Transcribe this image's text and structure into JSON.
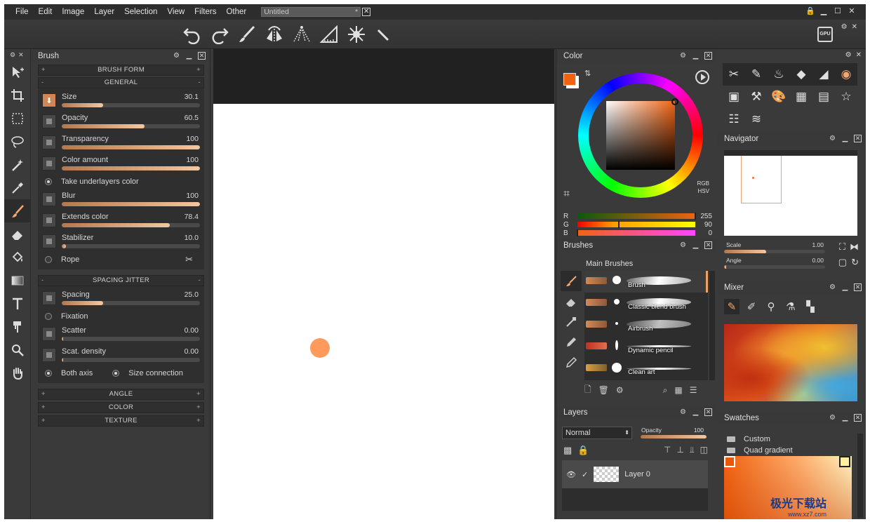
{
  "menu": [
    "File",
    "Edit",
    "Image",
    "Layer",
    "Selection",
    "View",
    "Filters",
    "Other"
  ],
  "document": {
    "tab_title": "Untitled",
    "modified_marker": "*"
  },
  "toolbar": {
    "gpu_label": "GPU",
    "icons": [
      "undo-icon",
      "redo-icon",
      "brush-tool-icon",
      "symmetry-icon",
      "perspective-icon",
      "ruler-triangle-icon",
      "mandala-icon",
      "straight-ruler-icon"
    ]
  },
  "left_tools": [
    "move-tool-icon",
    "crop-tool-icon",
    "rect-select-icon",
    "lasso-icon",
    "magic-wand-icon",
    "eyedropper-icon",
    "brush-icon",
    "eraser-icon",
    "fill-bucket-icon",
    "gradient-icon",
    "text-tool-icon",
    "clone-stamp-icon",
    "zoom-icon",
    "hand-icon"
  ],
  "brush_panel": {
    "title": "Brush",
    "sections": {
      "brush_form": "BRUSH FORM",
      "general": "GENERAL",
      "spacing_jitter": "SPACING JITTER",
      "angle": "ANGLE",
      "color": "COLOR",
      "texture": "TEXTURE"
    },
    "general": [
      {
        "label": "Size",
        "value": "30.1",
        "fill": 0.3
      },
      {
        "label": "Opacity",
        "value": "60.5",
        "fill": 0.6
      },
      {
        "label": "Transparency",
        "value": "100",
        "fill": 1.0
      },
      {
        "label": "Color amount",
        "value": "100",
        "fill": 1.0
      }
    ],
    "take_underlayers": "Take underlayers color",
    "general2": [
      {
        "label": "Blur",
        "value": "100",
        "fill": 1.0
      },
      {
        "label": "Extends color",
        "value": "78.4",
        "fill": 0.78
      },
      {
        "label": "Stabilizer",
        "value": "10.0",
        "fill": 0.03
      }
    ],
    "rope": "Rope",
    "spacing": [
      {
        "label": "Spacing",
        "value": "25.0",
        "fill": 0.3
      }
    ],
    "fixation": "Fixation",
    "spacing2": [
      {
        "label": "Scatter",
        "value": "0.00",
        "fill": 0.01
      },
      {
        "label": "Scat. density",
        "value": "0.00",
        "fill": 0.01
      }
    ],
    "both_axis": "Both axis",
    "size_connection": "Size connection"
  },
  "color_panel": {
    "title": "Color",
    "rgb_label": "RGB",
    "hsv_label": "HSV",
    "current_color": "#f06312",
    "channels": [
      {
        "label": "R",
        "value": "255",
        "fill": 1.0
      },
      {
        "label": "G",
        "value": "90",
        "fill": 0.35
      },
      {
        "label": "B",
        "value": "0",
        "fill": 0.0
      }
    ]
  },
  "brushes_panel": {
    "title": "Brushes",
    "group_title": "Main Brushes",
    "items": [
      "Brush",
      "Classic blend brush",
      "Airbrush",
      "Dynamic pencil",
      "Clean art"
    ]
  },
  "layers_panel": {
    "title": "Layers",
    "blend_mode": "Normal",
    "opacity_label": "Opacity",
    "opacity_value": "100",
    "layers": [
      {
        "name": "Layer 0"
      }
    ]
  },
  "navigator": {
    "title": "Navigator",
    "scale_label": "Scale",
    "scale_value": "1.00",
    "angle_label": "Angle",
    "angle_value": "0.00"
  },
  "mixer": {
    "title": "Mixer"
  },
  "swatches": {
    "title": "Swatches",
    "items": [
      "Custom",
      "Quad gradient"
    ]
  },
  "watermark": {
    "main": "极光下载站",
    "sub": "www.xz7.com"
  }
}
